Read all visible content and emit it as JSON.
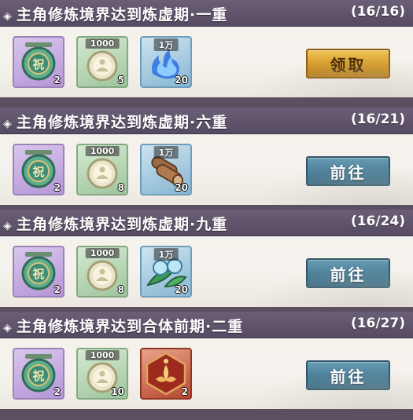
{
  "tasks": [
    {
      "title": "主角修炼境界达到炼虚期·一重",
      "progress": "(16/16)",
      "button_label": "领取",
      "button_type": "claim",
      "rewards": [
        {
          "icon": "blessing-charm-icon",
          "rarity": "purple",
          "tag": "",
          "count": "2"
        },
        {
          "icon": "meditation-token-icon",
          "rarity": "green",
          "tag": "1000",
          "count": "5"
        },
        {
          "icon": "blue-spirit-flame-icon",
          "rarity": "blue",
          "tag": "1万",
          "count": "20"
        }
      ]
    },
    {
      "title": "主角修炼境界达到炼虚期·六重",
      "progress": "(16/21)",
      "button_label": "前往",
      "button_type": "go",
      "rewards": [
        {
          "icon": "blessing-charm-icon",
          "rarity": "purple",
          "tag": "",
          "count": "2"
        },
        {
          "icon": "meditation-token-icon",
          "rarity": "green",
          "tag": "1000",
          "count": "8"
        },
        {
          "icon": "wood-logs-icon",
          "rarity": "blue",
          "tag": "1万",
          "count": "20"
        }
      ]
    },
    {
      "title": "主角修炼境界达到炼虚期·九重",
      "progress": "(16/24)",
      "button_label": "前往",
      "button_type": "go",
      "rewards": [
        {
          "icon": "blessing-charm-icon",
          "rarity": "purple",
          "tag": "",
          "count": "2"
        },
        {
          "icon": "meditation-token-icon",
          "rarity": "green",
          "tag": "1000",
          "count": "8"
        },
        {
          "icon": "dew-leaf-icon",
          "rarity": "blue",
          "tag": "1万",
          "count": "20"
        }
      ]
    },
    {
      "title": "主角修炼境界达到合体前期·二重",
      "progress": "(16/27)",
      "button_label": "前往",
      "button_type": "go",
      "rewards": [
        {
          "icon": "blessing-charm-icon",
          "rarity": "purple",
          "tag": "",
          "count": "2"
        },
        {
          "icon": "meditation-token-icon",
          "rarity": "green",
          "tag": "1000",
          "count": "10"
        },
        {
          "icon": "red-lotus-card-icon",
          "rarity": "red",
          "tag": "",
          "count": "2"
        }
      ]
    }
  ],
  "colors": {
    "header": "#5f546b",
    "card": "#f4f1ec",
    "claim_button": "#d9a232",
    "go_button": "#4b7f98"
  }
}
